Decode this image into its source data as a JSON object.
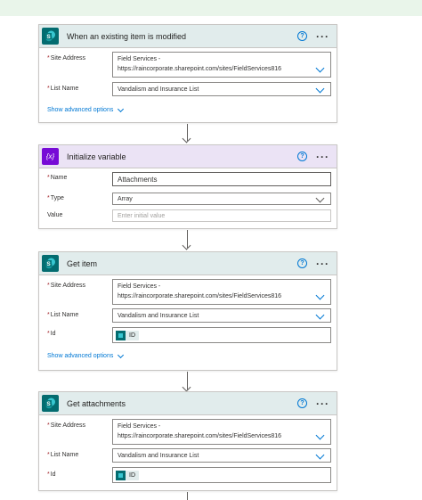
{
  "colors": {
    "sharepoint_icon": "#036c70",
    "variable_icon": "#770bd6",
    "sharepoint_header": "#e1ecec",
    "variable_header": "#ebe3f5",
    "link": "#0078d4",
    "required": "#a4262c"
  },
  "icons": {
    "sharepoint": "sharepoint-icon",
    "variable": "variable-icon",
    "help": "help-icon",
    "more": "more-options-icon",
    "chevron": "chevron-down-icon"
  },
  "glyphs": {
    "sp": "S",
    "var": "{x}",
    "help": "?",
    "more": "···",
    "required": "*"
  },
  "trigger": {
    "title": "When an existing item is modified",
    "site_label": "Site Address",
    "site_value_line1": "Field Services -",
    "site_value_line2": "https://raincorporate.sharepoint.com/sites/FieldServices816",
    "list_label": "List Name",
    "list_value": "Vandalism and Insurance List",
    "advanced": "Show advanced options"
  },
  "init_var": {
    "title": "Initialize variable",
    "name_label": "Name",
    "name_value": "Attachments",
    "type_label": "Type",
    "type_value": "Array",
    "value_label": "Value",
    "value_placeholder": "Enter initial value"
  },
  "get_item": {
    "title": "Get item",
    "site_label": "Site Address",
    "site_value_line1": "Field Services -",
    "site_value_line2": "https://raincorporate.sharepoint.com/sites/FieldServices816",
    "list_label": "List Name",
    "list_value": "Vandalism and Insurance List",
    "id_label": "Id",
    "id_token": "ID",
    "advanced": "Show advanced options"
  },
  "get_attachments": {
    "title": "Get attachments",
    "site_label": "Site Address",
    "site_value_line1": "Field Services -",
    "site_value_line2": "https://raincorporate.sharepoint.com/sites/FieldServices816",
    "list_label": "List Name",
    "list_value": "Vandalism and Insurance List",
    "id_label": "Id",
    "id_token": "ID"
  }
}
